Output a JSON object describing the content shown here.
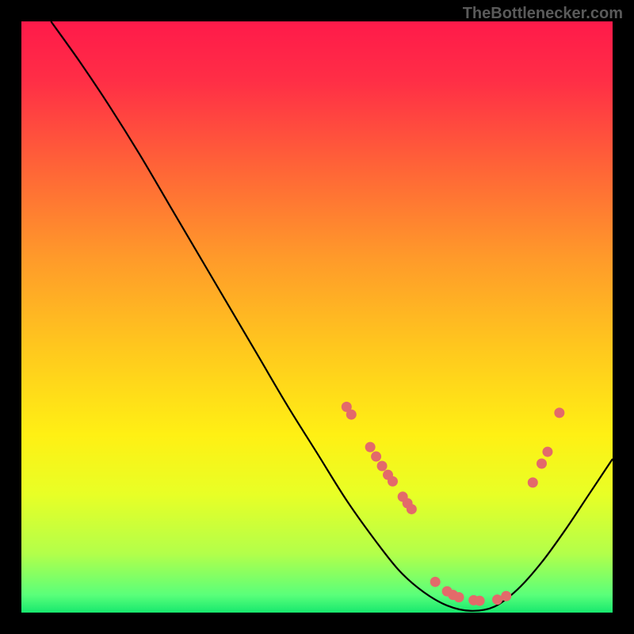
{
  "watermark": "TheBottlenecker.com",
  "chart_data": {
    "type": "line",
    "title": "",
    "xlabel": "",
    "ylabel": "",
    "xlim": [
      0,
      100
    ],
    "ylim": [
      0,
      100
    ],
    "background": {
      "type": "vertical-gradient",
      "stops": [
        {
          "offset": 0.0,
          "color": "#ff1a4a"
        },
        {
          "offset": 0.1,
          "color": "#ff2e46"
        },
        {
          "offset": 0.25,
          "color": "#ff6537"
        },
        {
          "offset": 0.4,
          "color": "#ff9a2a"
        },
        {
          "offset": 0.55,
          "color": "#ffc71e"
        },
        {
          "offset": 0.7,
          "color": "#fff014"
        },
        {
          "offset": 0.8,
          "color": "#e8ff26"
        },
        {
          "offset": 0.9,
          "color": "#b3ff4a"
        },
        {
          "offset": 0.97,
          "color": "#5aff7a"
        },
        {
          "offset": 1.0,
          "color": "#17e86e"
        }
      ]
    },
    "series": [
      {
        "name": "curve",
        "stroke": "#000000",
        "x": [
          5,
          10,
          15,
          20,
          25,
          30,
          35,
          40,
          45,
          50,
          55,
          60,
          64,
          68,
          72,
          76,
          80,
          84,
          88,
          92,
          96,
          100
        ],
        "values": [
          100,
          93,
          85.5,
          77.5,
          69,
          60.5,
          52,
          43.5,
          35,
          27,
          19,
          12,
          7,
          3.5,
          1.2,
          0.3,
          1.0,
          4,
          8.5,
          14,
          20,
          26
        ]
      }
    ],
    "markers": {
      "color": "#e36a6a",
      "points": [
        {
          "x": 55.0,
          "y": 34.8
        },
        {
          "x": 55.8,
          "y": 33.5
        },
        {
          "x": 59.0,
          "y": 28.0
        },
        {
          "x": 60.0,
          "y": 26.4
        },
        {
          "x": 61.0,
          "y": 24.8
        },
        {
          "x": 62.0,
          "y": 23.3
        },
        {
          "x": 62.8,
          "y": 22.2
        },
        {
          "x": 64.5,
          "y": 19.6
        },
        {
          "x": 65.3,
          "y": 18.5
        },
        {
          "x": 66.0,
          "y": 17.5
        },
        {
          "x": 70.0,
          "y": 5.2
        },
        {
          "x": 72.0,
          "y": 3.6
        },
        {
          "x": 73.0,
          "y": 3.0
        },
        {
          "x": 74.0,
          "y": 2.6
        },
        {
          "x": 76.5,
          "y": 2.1
        },
        {
          "x": 77.5,
          "y": 2.0
        },
        {
          "x": 80.5,
          "y": 2.2
        },
        {
          "x": 82.0,
          "y": 2.8
        },
        {
          "x": 86.5,
          "y": 22.0
        },
        {
          "x": 88.0,
          "y": 25.2
        },
        {
          "x": 89.0,
          "y": 27.2
        },
        {
          "x": 91.0,
          "y": 33.8
        }
      ]
    }
  }
}
